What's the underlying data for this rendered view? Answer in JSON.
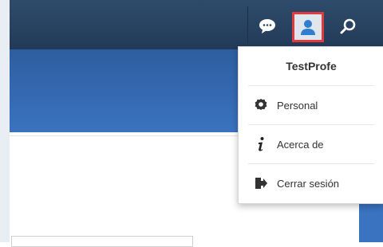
{
  "topbar": {
    "icons": [
      "chat-icon",
      "user-icon",
      "search-icon"
    ]
  },
  "user_menu": {
    "username": "TestProfe",
    "items": [
      {
        "label": "Personal",
        "icon": "gear-icon"
      },
      {
        "label": "Acerca de",
        "icon": "info-icon"
      },
      {
        "label": "Cerrar sesión",
        "icon": "logout-icon"
      }
    ]
  },
  "colors": {
    "topbar": "#2a4463",
    "band": "#3368ad",
    "highlight_border": "#e23b3b"
  }
}
